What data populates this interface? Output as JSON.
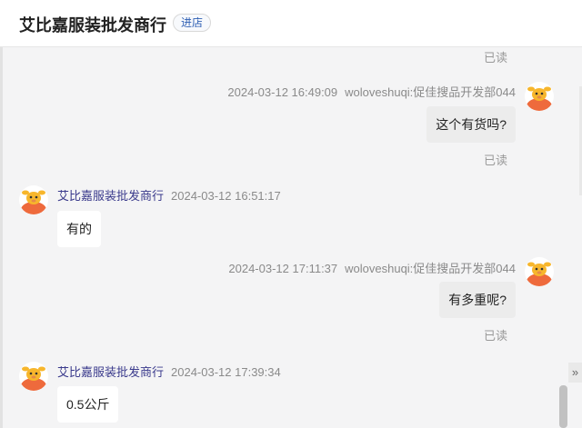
{
  "header": {
    "shop_name": "艾比嘉服装批发商行",
    "enter_label": "进店"
  },
  "messages": [
    {
      "direction": "out",
      "read": "已读"
    },
    {
      "direction": "out",
      "time": "2024-03-12 16:49:09",
      "sender": "woloveshuqi:促佳搜品开发部044",
      "text": "这个有货吗?",
      "read": "已读"
    },
    {
      "direction": "in",
      "sender": "艾比嘉服装批发商行",
      "time": "2024-03-12 16:51:17",
      "text": "有的"
    },
    {
      "direction": "out",
      "time": "2024-03-12 17:11:37",
      "sender": "woloveshuqi:促佳搜品开发部044",
      "text": "有多重呢?",
      "read": "已读"
    },
    {
      "direction": "in",
      "sender": "艾比嘉服装批发商行",
      "time": "2024-03-12 17:39:34",
      "text": "0.5公斤"
    }
  ],
  "controls": {
    "collapse_label": "»"
  },
  "colors": {
    "avatar_body": "#ee6a3c",
    "avatar_head": "#f7b62c",
    "sender_link": "#3a3a8c"
  }
}
